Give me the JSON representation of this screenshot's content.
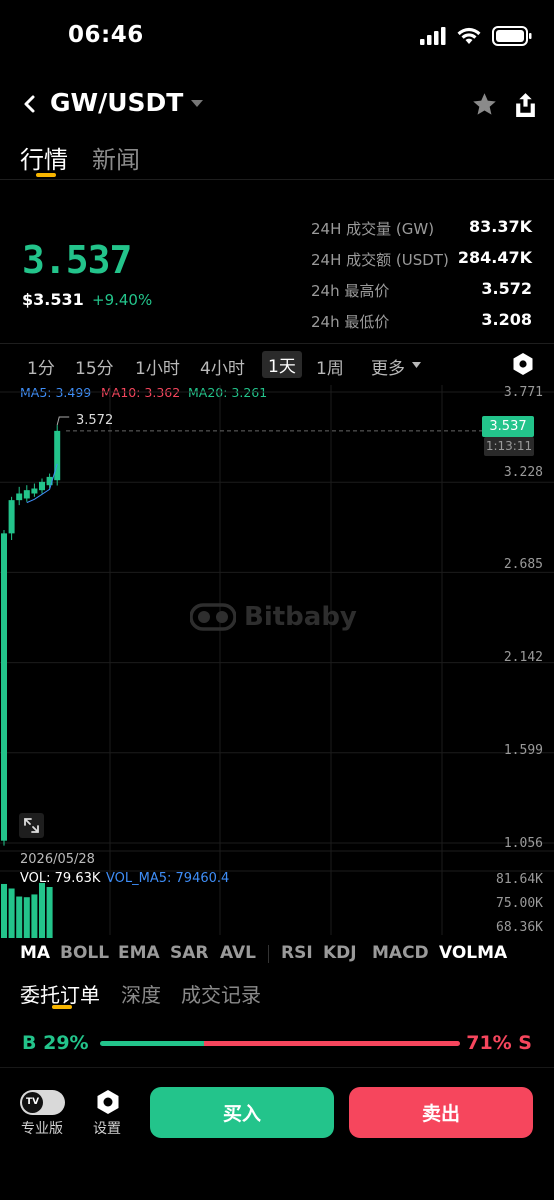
{
  "status_bar": {
    "time": "06:46"
  },
  "header": {
    "pair": "GW/USDT"
  },
  "top_tabs": [
    {
      "label": "行情",
      "active": true
    },
    {
      "label": "新闻",
      "active": false
    }
  ],
  "ticker": {
    "last_price": "3.537",
    "usd_price": "$3.531",
    "change_pct": "+9.40%",
    "stats": [
      {
        "label": "24H 成交量 (GW)",
        "value": "83.37K"
      },
      {
        "label": "24H 成交额 (USDT)",
        "value": "284.47K"
      },
      {
        "label": "24h 最高价",
        "value": "3.572"
      },
      {
        "label": "24h 最低价",
        "value": "3.208"
      }
    ]
  },
  "intervals": [
    {
      "label": "1分",
      "active": false
    },
    {
      "label": "15分",
      "active": false
    },
    {
      "label": "1小时",
      "active": false
    },
    {
      "label": "4小时",
      "active": false
    },
    {
      "label": "1天",
      "active": true
    },
    {
      "label": "1周",
      "active": false
    },
    {
      "label": "更多",
      "active": false
    }
  ],
  "ma": {
    "ma5": "MA5: 3.499",
    "ma10": "MA10: 3.362",
    "ma20": "MA20: 3.261"
  },
  "chart_axis": {
    "price_ticks": [
      "3.771",
      "3.228",
      "2.685",
      "2.142",
      "1.599",
      "1.056"
    ],
    "volume_ticks": [
      "81.64K",
      "75.00K",
      "68.36K"
    ],
    "current_price": "3.537",
    "countdown": "1:13:11",
    "high_marker": "3.572",
    "watermark": "Bitbaby",
    "date": "2026/05/28",
    "vol": "VOL: 79.63K",
    "vol_ma5": "VOL_MA5: 79460.4"
  },
  "chart_data": {
    "type": "candlestick",
    "y_range": [
      1.056,
      3.771
    ],
    "candles": [
      {
        "open": 1.07,
        "close": 2.92,
        "high": 2.94,
        "low": 1.04
      },
      {
        "open": 2.92,
        "close": 3.12,
        "high": 3.14,
        "low": 2.88
      },
      {
        "open": 3.12,
        "close": 3.16,
        "high": 3.2,
        "low": 3.09
      },
      {
        "open": 3.13,
        "close": 3.18,
        "high": 3.21,
        "low": 3.11
      },
      {
        "open": 3.16,
        "close": 3.19,
        "high": 3.22,
        "low": 3.14
      },
      {
        "open": 3.18,
        "close": 3.23,
        "high": 3.25,
        "low": 3.16
      },
      {
        "open": 3.21,
        "close": 3.26,
        "high": 3.28,
        "low": 3.19
      },
      {
        "open": 3.24,
        "close": 3.537,
        "high": 3.572,
        "low": 3.208
      }
    ],
    "volume_range": [
      65.0,
      81.64
    ],
    "volumes": [
      80.5,
      79.2,
      76.9,
      76.7,
      77.5,
      80.8,
      79.63
    ]
  },
  "indicators": [
    {
      "label": "MA",
      "active": true
    },
    {
      "label": "BOLL",
      "active": false
    },
    {
      "label": "EMA",
      "active": false
    },
    {
      "label": "SAR",
      "active": false
    },
    {
      "label": "AVL",
      "active": false
    },
    {
      "label": "RSI",
      "active": false
    },
    {
      "label": "KDJ",
      "active": false
    },
    {
      "label": "MACD",
      "active": false
    },
    {
      "label": "VOLMA",
      "active": true
    }
  ],
  "bottom_tabs": [
    {
      "label": "委托订单",
      "active": true
    },
    {
      "label": "深度",
      "active": false
    },
    {
      "label": "成交记录",
      "active": false
    }
  ],
  "ratio": {
    "buy_label": "B 29%",
    "sell_label": "71% S",
    "buy_fraction": 0.29
  },
  "footer": {
    "pro_label": "专业版",
    "toggle_text": "TV",
    "settings_label": "设置",
    "buy_label": "买入",
    "sell_label": "卖出"
  },
  "colors": {
    "up": "#23c48b",
    "down": "#f6465d",
    "accent": "#f7b500",
    "ma5": "#3f8ef7",
    "ma10": "#f6465d",
    "ma20": "#23c48b"
  }
}
